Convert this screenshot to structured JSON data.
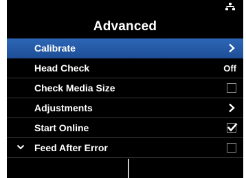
{
  "screen": {
    "title": "Advanced",
    "status_icon": "network-icon"
  },
  "menu": {
    "items": [
      {
        "label": "Calibrate",
        "control": "chevron-right-icon",
        "selected": true
      },
      {
        "label": "Head Check",
        "value": "Off"
      },
      {
        "label": "Check Media Size",
        "control": "checkbox",
        "checked": false
      },
      {
        "label": "Adjustments",
        "control": "chevron-right-icon"
      },
      {
        "label": "Start Online",
        "control": "checkbox",
        "checked": true
      },
      {
        "label": "Feed After Error",
        "control": "checkbox",
        "checked": false
      }
    ],
    "more_indicator": "chevron-down-icon"
  },
  "softkeys": {
    "left_label": "",
    "right_label": ""
  },
  "colors": {
    "background": "#000000",
    "selection": "#2557a7",
    "text": "#ffffff"
  }
}
